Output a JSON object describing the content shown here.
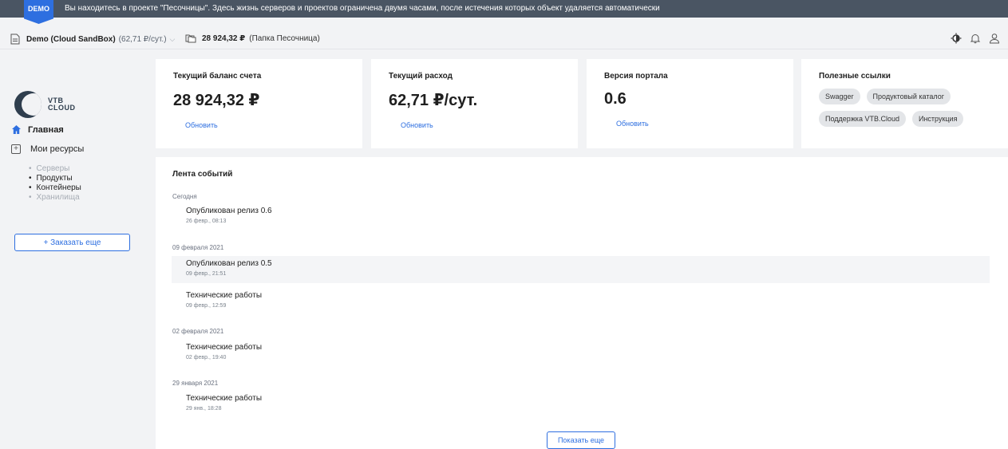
{
  "banner": {
    "tag": "DEMO",
    "text": "Вы находитесь в проекте \"Песочницы\". Здесь жизнь серверов и проектов ограничена двумя часами, после истечения которых объект удаляется автоматически"
  },
  "topbar": {
    "project_name": "Demo (Cloud SandBox)",
    "project_rate": "(62,71 ₽/сут.)",
    "folder_balance": "28 924,32 ₽",
    "folder_name": "(Папка Песочница)",
    "icons": [
      "theme-toggle-icon",
      "bell-icon",
      "user-icon"
    ]
  },
  "logo": {
    "line1": "VTB",
    "line2": "CLOUD"
  },
  "sidebar": {
    "home": "Главная",
    "resources": "Мои ресурсы",
    "items": [
      {
        "label": "Серверы",
        "active": false
      },
      {
        "label": "Продукты",
        "active": true
      },
      {
        "label": "Контейнеры",
        "active": true
      },
      {
        "label": "Хранилища",
        "active": false
      }
    ],
    "order_button": "+ Заказать еще"
  },
  "cards": {
    "balance": {
      "title": "Текущий баланс счета",
      "value": "28 924,32 ₽",
      "link": "Обновить"
    },
    "expense": {
      "title": "Текущий расход",
      "value": "62,71 ₽/сут.",
      "link": "Обновить"
    },
    "version": {
      "title": "Версия портала",
      "value": "0.6",
      "link": "Обновить"
    },
    "links": {
      "title": "Полезные ссылки",
      "chips": [
        "Swagger",
        "Продуктовый каталог",
        "Поддержка VTB.Cloud",
        "Инструкция"
      ]
    }
  },
  "feed": {
    "title": "Лента событий",
    "groups": [
      {
        "date": "Сегодня",
        "events": [
          {
            "title": "Опубликован релиз 0.6",
            "time": "26 февр., 08:13"
          }
        ]
      },
      {
        "date": "09 февраля 2021",
        "events": [
          {
            "title": "Опубликован релиз 0.5",
            "time": "09 февр., 21:51"
          },
          {
            "title": "Технические работы",
            "time": "09 февр., 12:59"
          }
        ]
      },
      {
        "date": "02 февраля 2021",
        "events": [
          {
            "title": "Технические работы",
            "time": "02 февр., 19:40"
          }
        ]
      },
      {
        "date": "29 января 2021",
        "events": [
          {
            "title": "Технические работы",
            "time": "29 янв., 18:28"
          }
        ]
      }
    ],
    "more_button": "Показать еще"
  },
  "colors": {
    "accent": "#2e6fe0",
    "banner_bg": "#4a5563",
    "page_bg": "#f2f3f5"
  }
}
